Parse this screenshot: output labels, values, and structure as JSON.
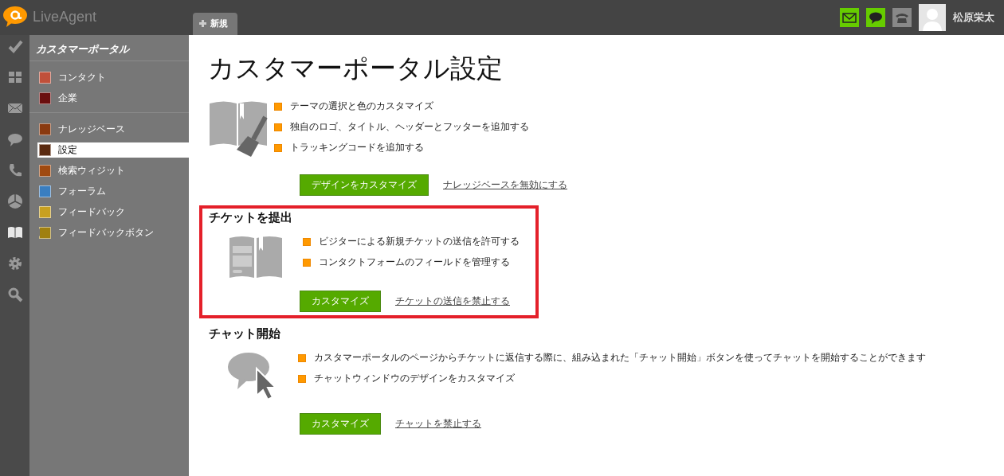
{
  "app": {
    "logo": "LiveAgent"
  },
  "tabs": [
    {
      "label": "新規",
      "selected": true
    }
  ],
  "header": {
    "icons": [
      {
        "kind": "mail",
        "on": true
      },
      {
        "kind": "chat",
        "on": true
      },
      {
        "kind": "phone",
        "on": false
      }
    ],
    "user": "松原栄太"
  },
  "rail": [
    {
      "kind": "check",
      "selected": false
    },
    {
      "kind": "grid",
      "selected": false
    },
    {
      "kind": "mail",
      "selected": false
    },
    {
      "kind": "chat",
      "selected": false
    },
    {
      "kind": "phone",
      "selected": false
    },
    {
      "kind": "pie",
      "selected": false
    },
    {
      "kind": "book",
      "selected": true
    },
    {
      "kind": "gear",
      "selected": false
    },
    {
      "kind": "search",
      "selected": false
    }
  ],
  "sidebar": {
    "title": "カスタマーポータル",
    "groups": [
      [
        {
          "label": "コンタクト",
          "color": "#c0503a",
          "selected": false
        },
        {
          "label": "企業",
          "color": "#6a0f0f",
          "selected": false
        }
      ],
      [
        {
          "label": "ナレッジベース",
          "color": "#8a3a10",
          "selected": false
        },
        {
          "label": "設定",
          "color": "#5a2a10",
          "selected": true
        },
        {
          "label": "検索ウィジット",
          "color": "#a04a10",
          "selected": false
        },
        {
          "label": "フォーラム",
          "color": "#3a7ec0",
          "selected": false
        },
        {
          "label": "フィードバック",
          "color": "#c8a020",
          "selected": false
        },
        {
          "label": "フィードバックボタン",
          "color": "#a08010",
          "selected": false
        }
      ]
    ]
  },
  "page": {
    "title": "カスタマーポータル設定",
    "sections": [
      {
        "highlighted": false,
        "bullets": [
          "テーマの選択と色のカスタマイズ",
          "独自のロゴ、タイトル、ヘッダーとフッターを追加する",
          "トラッキングコードを追加する"
        ],
        "button": "デザインをカスタマイズ",
        "link": "ナレッジベースを無効にする"
      },
      {
        "title": "チケットを提出",
        "highlighted": true,
        "bullets": [
          "ビジターによる新規チケットの送信を許可する",
          "コンタクトフォームのフィールドを管理する"
        ],
        "button": "カスタマイズ",
        "link": "チケットの送信を禁止する"
      },
      {
        "title": "チャット開始",
        "highlighted": false,
        "bullets": [
          "カスタマーポータルのページからチケットに返信する際に、組み込まれた「チャット開始」ボタンを使ってチャットを開始することができます",
          "チャットウィンドウのデザインをカスタマイズ"
        ],
        "button": "カスタマイズ",
        "link": "チャットを禁止する"
      }
    ]
  }
}
